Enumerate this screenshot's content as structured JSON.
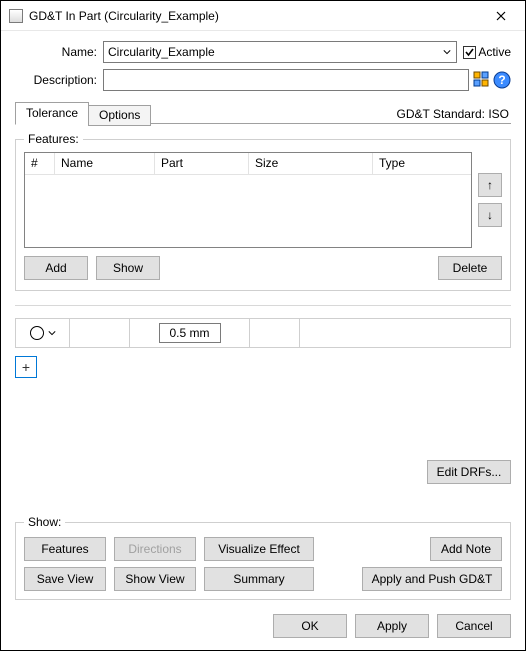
{
  "window": {
    "title": "GD&T In Part (Circularity_Example)"
  },
  "form": {
    "name_label": "Name:",
    "name_value": "Circularity_Example",
    "active_label": "Active",
    "active_checked": true,
    "description_label": "Description:",
    "description_value": ""
  },
  "standard_label": "GD&T Standard: ISO",
  "tabs": {
    "tolerance": "Tolerance",
    "options": "Options"
  },
  "features": {
    "legend": "Features:",
    "columns": {
      "num": "#",
      "name": "Name",
      "part": "Part",
      "size": "Size",
      "type": "Type"
    },
    "rows": [],
    "buttons": {
      "add": "Add",
      "show": "Show",
      "delete": "Delete"
    },
    "arrows": {
      "up": "↑",
      "down": "↓"
    }
  },
  "tolerance": {
    "symbol_name": "circularity",
    "value": "0.5 mm",
    "add_row": "+"
  },
  "edit_drfs": "Edit DRFs...",
  "show": {
    "legend": "Show:",
    "features": "Features",
    "directions": "Directions",
    "visualize": "Visualize Effect",
    "add_note": "Add Note",
    "save_view": "Save View",
    "show_view": "Show View",
    "summary": "Summary",
    "apply_push": "Apply and Push GD&T"
  },
  "footer": {
    "ok": "OK",
    "apply": "Apply",
    "cancel": "Cancel"
  }
}
